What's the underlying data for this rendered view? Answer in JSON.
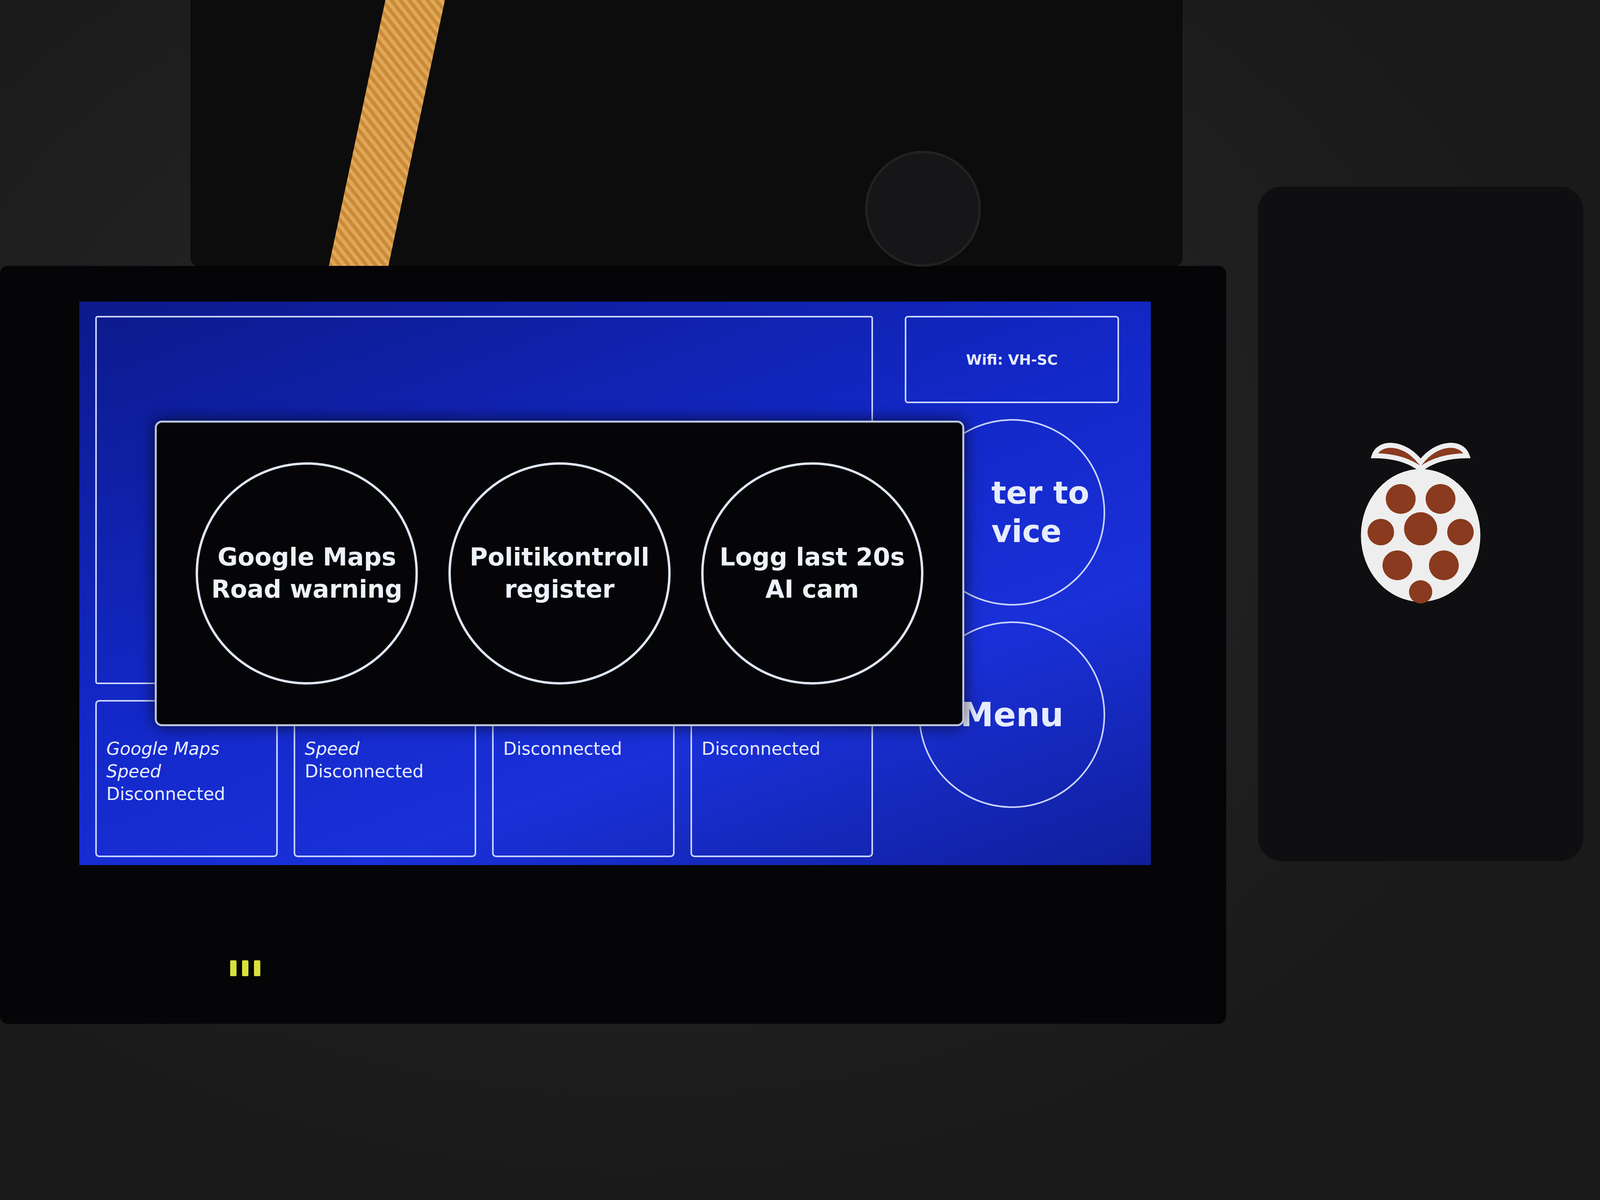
{
  "screen": {
    "wifi": "Wifi: VH-SC",
    "side_buttons": [
      {
        "lines": [
          "ter to",
          "vice"
        ],
        "kind": "cut"
      },
      {
        "lines": [
          "Menu"
        ],
        "kind": "full"
      }
    ],
    "tiles": [
      {
        "lines": [
          "Google Maps",
          "Speed"
        ],
        "status": "Disconnected"
      },
      {
        "lines": [
          "Speed"
        ],
        "status": "Disconnected"
      },
      {
        "lines": [],
        "status": "Disconnected"
      },
      {
        "lines": [],
        "status": "Disconnected"
      }
    ]
  },
  "popup": {
    "buttons": [
      {
        "lines": [
          "Google Maps",
          "Road warning"
        ]
      },
      {
        "lines": [
          "Politikontroll",
          "register"
        ]
      },
      {
        "lines": [
          "Logg last 20s",
          "AI cam"
        ]
      }
    ]
  }
}
